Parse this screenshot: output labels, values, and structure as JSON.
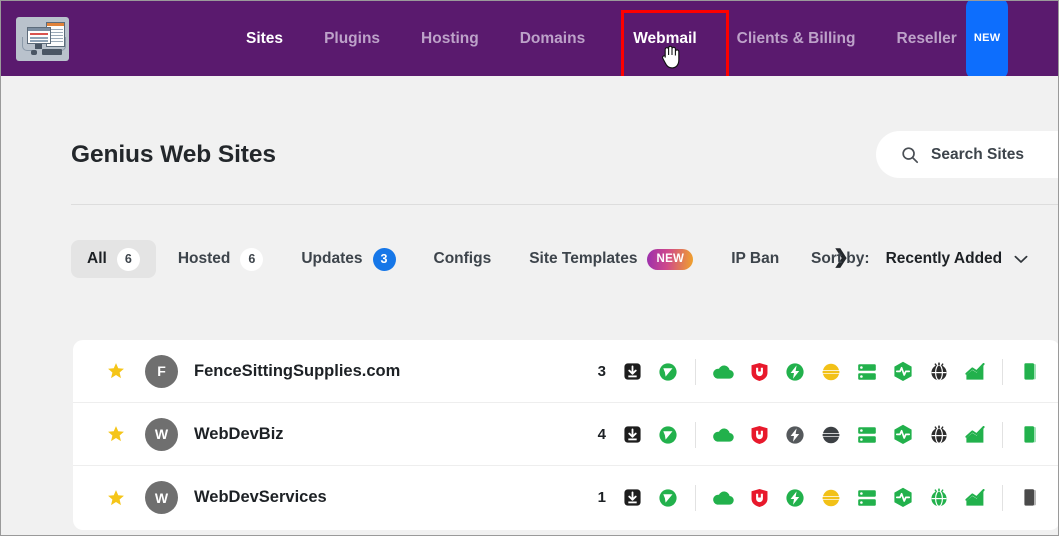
{
  "nav": {
    "logo_alt": "computer-workstation-logo",
    "items": [
      {
        "label": "Sites",
        "active": true,
        "badge": null
      },
      {
        "label": "Plugins",
        "active": false,
        "badge": null
      },
      {
        "label": "Hosting",
        "active": false,
        "badge": null
      },
      {
        "label": "Domains",
        "active": false,
        "badge": null
      },
      {
        "label": "Webmail",
        "active": true,
        "badge": null
      },
      {
        "label": "Clients & Billing",
        "active": false,
        "badge": null
      },
      {
        "label": "Reseller",
        "active": false,
        "badge": "NEW"
      }
    ],
    "highlight_target": "Webmail",
    "bg_color": "#5a1a6e",
    "highlight_color": "#fe0000",
    "badge_color": "#0d6efd"
  },
  "page": {
    "title": "Genius Web Sites"
  },
  "search": {
    "placeholder": "Search Sites",
    "value": "",
    "icon": "search-icon"
  },
  "tabs": {
    "items": [
      {
        "label": "All",
        "count": "6",
        "active": true,
        "badge_style": "white"
      },
      {
        "label": "Hosted",
        "count": "6",
        "active": false,
        "badge_style": "white"
      },
      {
        "label": "Updates",
        "count": "3",
        "active": false,
        "badge_style": "blue"
      },
      {
        "label": "Configs",
        "count": null,
        "active": false,
        "badge_style": null
      },
      {
        "label": "Site Templates",
        "count": "NEW",
        "active": false,
        "badge_style": "grad"
      },
      {
        "label": "IP Ban",
        "count": null,
        "active": false,
        "badge_style": null
      }
    ],
    "scroll_next": "❯"
  },
  "sort": {
    "label": "Sort by:",
    "value": "Recently Added",
    "chevron": "chevron-down-icon"
  },
  "sites": {
    "columns": [
      "favorite",
      "avatar",
      "name",
      "updates",
      "status_icons"
    ],
    "rows": [
      {
        "favorite": true,
        "initial": "F",
        "name": "FenceSittingSupplies.com",
        "updates": "3",
        "icons": [
          {
            "name": "download-updates-icon",
            "color": "#1d1d1d"
          },
          {
            "name": "site-shield-icon",
            "color": "#22b14c"
          },
          {
            "name": "cloud-icon",
            "color": "#22b14c"
          },
          {
            "name": "security-shield-icon",
            "color": "#e8192c"
          },
          {
            "name": "speed-bolt-icon",
            "color": "#22b14c"
          },
          {
            "name": "cache-sun-icon",
            "color": "#f2c117"
          },
          {
            "name": "server-stack-icon",
            "color": "#22b14c"
          },
          {
            "name": "uptime-pulse-icon",
            "color": "#22b14c"
          },
          {
            "name": "globe-cdn-icon",
            "color": "#2b2b2b"
          },
          {
            "name": "analytics-chart-icon",
            "color": "#22b14c"
          },
          {
            "name": "clone-site-icon",
            "color": "#22b14c"
          }
        ]
      },
      {
        "favorite": true,
        "initial": "W",
        "name": "WebDevBiz",
        "updates": "4",
        "icons": [
          {
            "name": "download-updates-icon",
            "color": "#1d1d1d"
          },
          {
            "name": "site-shield-icon",
            "color": "#22b14c"
          },
          {
            "name": "cloud-icon",
            "color": "#22b14c"
          },
          {
            "name": "security-shield-icon",
            "color": "#e8192c"
          },
          {
            "name": "speed-bolt-icon",
            "color": "#55595c"
          },
          {
            "name": "cache-sun-icon",
            "color": "#3c4044"
          },
          {
            "name": "server-stack-icon",
            "color": "#22b14c"
          },
          {
            "name": "uptime-pulse-icon",
            "color": "#22b14c"
          },
          {
            "name": "globe-cdn-icon",
            "color": "#2b2b2b"
          },
          {
            "name": "analytics-chart-icon",
            "color": "#22b14c"
          },
          {
            "name": "clone-site-icon",
            "color": "#22b14c"
          }
        ]
      },
      {
        "favorite": true,
        "initial": "W",
        "name": "WebDevServices",
        "updates": "1",
        "icons": [
          {
            "name": "download-updates-icon",
            "color": "#1d1d1d"
          },
          {
            "name": "site-shield-icon",
            "color": "#22b14c"
          },
          {
            "name": "cloud-icon",
            "color": "#22b14c"
          },
          {
            "name": "security-shield-icon",
            "color": "#e8192c"
          },
          {
            "name": "speed-bolt-icon",
            "color": "#22b14c"
          },
          {
            "name": "cache-sun-icon",
            "color": "#f2c117"
          },
          {
            "name": "server-stack-icon",
            "color": "#22b14c"
          },
          {
            "name": "uptime-pulse-icon",
            "color": "#22b14c"
          },
          {
            "name": "globe-cdn-icon",
            "color": "#22b14c"
          },
          {
            "name": "analytics-chart-icon",
            "color": "#22b14c"
          },
          {
            "name": "clone-site-icon",
            "color": "#4a4a4a"
          }
        ]
      }
    ]
  },
  "colors": {
    "nav_bg": "#5a1a6e",
    "page_bg": "#f1f1f1",
    "card_bg": "#ffffff",
    "star": "#f5c518",
    "green": "#22b14c",
    "red": "#e8192c",
    "yellow": "#f2c117"
  }
}
